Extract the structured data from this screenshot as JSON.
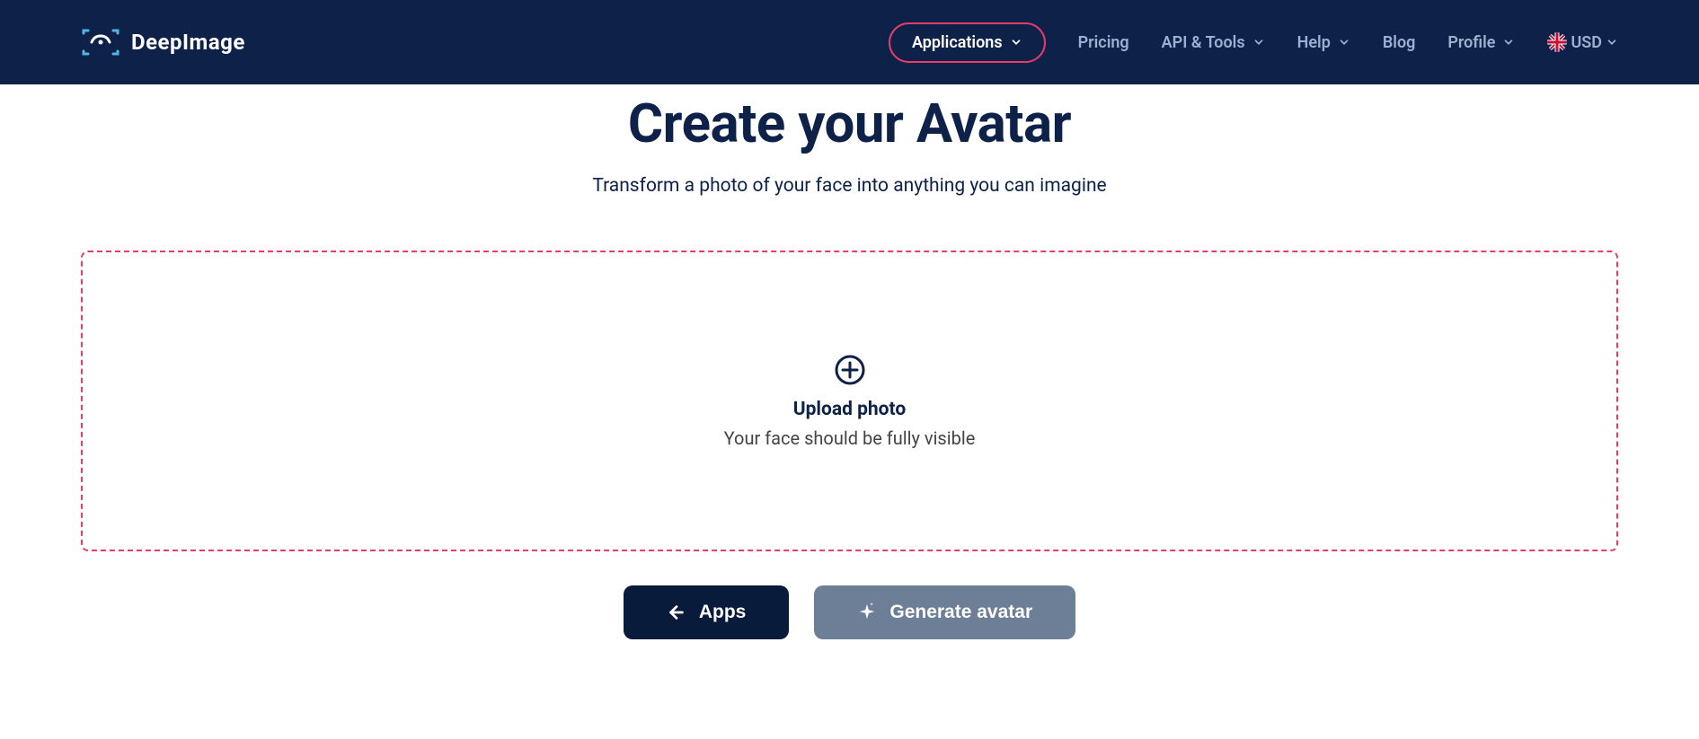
{
  "brand": {
    "name": "DeepImage"
  },
  "nav": {
    "applications": "Applications",
    "pricing": "Pricing",
    "api_tools": "API & Tools",
    "help": "Help",
    "blog": "Blog",
    "profile": "Profile",
    "currency": "USD"
  },
  "page": {
    "title": "Create your Avatar",
    "subtitle": "Transform a photo of your face into anything you can imagine"
  },
  "upload": {
    "title": "Upload photo",
    "hint": "Your face should be fully visible"
  },
  "actions": {
    "back": "Apps",
    "generate": "Generate avatar"
  }
}
